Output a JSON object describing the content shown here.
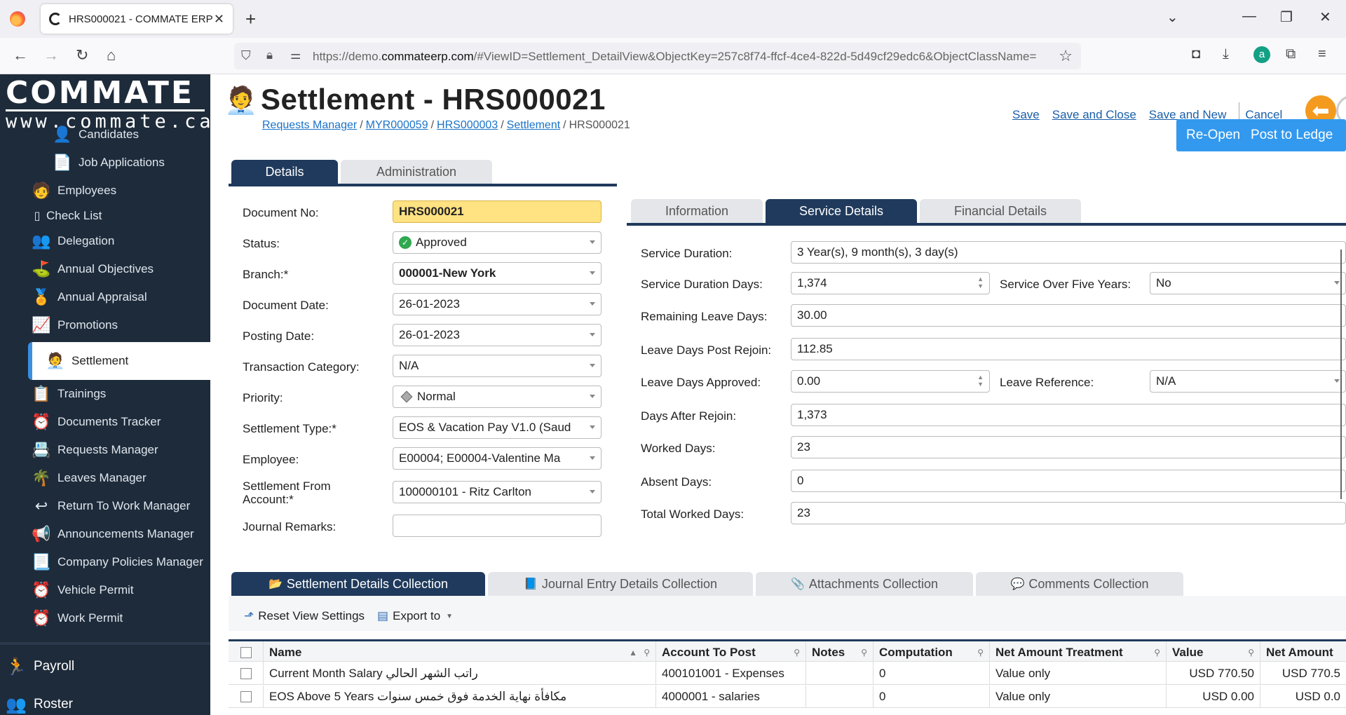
{
  "browser": {
    "tab_title": "HRS000021 - COMMATE ERP",
    "url_prefix": "https://demo.",
    "url_domain": "commateerp.com",
    "url_rest": "/#ViewID=Settlement_DetailView&ObjectKey=257c8f74-ffcf-4ce4-822d-5d49cf29edc6&ObjectClassName="
  },
  "sidebar": {
    "brand": "COMMATE",
    "site": "www.commate.ca",
    "items": [
      {
        "label": "Candidates",
        "icon": "candidate-icon"
      },
      {
        "label": "Job Applications",
        "icon": "document-icon"
      },
      {
        "label": "Employees",
        "icon": "employee-icon"
      },
      {
        "label": "Check List",
        "icon": "checklist-icon"
      },
      {
        "label": "Delegation",
        "icon": "delegation-icon"
      },
      {
        "label": "Annual Objectives",
        "icon": "golf-flag-icon"
      },
      {
        "label": "Annual Appraisal",
        "icon": "award-icon"
      },
      {
        "label": "Promotions",
        "icon": "promotion-icon"
      },
      {
        "label": "Settlement",
        "icon": "settlement-icon"
      },
      {
        "label": "Trainings",
        "icon": "training-icon"
      },
      {
        "label": "Documents Tracker",
        "icon": "clock-icon"
      },
      {
        "label": "Requests Manager",
        "icon": "requests-icon"
      },
      {
        "label": "Leaves Manager",
        "icon": "palm-tree-icon"
      },
      {
        "label": "Return To Work Manager",
        "icon": "return-icon"
      },
      {
        "label": "Announcements Manager",
        "icon": "megaphone-icon"
      },
      {
        "label": "Company Policies Manager",
        "icon": "policy-icon"
      },
      {
        "label": "Vehicle Permit",
        "icon": "clock-icon"
      },
      {
        "label": "Work Permit",
        "icon": "clock-icon"
      }
    ],
    "sections": [
      {
        "label": "Payroll",
        "icon": "payroll-icon"
      },
      {
        "label": "Roster",
        "icon": "roster-icon"
      }
    ]
  },
  "header": {
    "title": "Settlement - HRS000021",
    "breadcrumb": [
      "Requests Manager",
      "MYR000059",
      "HRS000003",
      "Settlement",
      "HRS000021"
    ],
    "actions": [
      "Save",
      "Save and Close",
      "Save and New",
      "Cancel"
    ],
    "reopen_label": "Re-Open",
    "post_label": "Post to Ledge"
  },
  "left_tabs": [
    "Details",
    "Administration"
  ],
  "form": [
    {
      "label": "Document No:",
      "value": "HRS000021"
    },
    {
      "label": "Status:",
      "value": "Approved"
    },
    {
      "label": "Branch:*",
      "value": "000001-New York"
    },
    {
      "label": "Document Date:",
      "value": "26-01-2023"
    },
    {
      "label": "Posting Date:",
      "value": "26-01-2023"
    },
    {
      "label": "Transaction Category:",
      "value": "N/A"
    },
    {
      "label": "Priority:",
      "value": "Normal"
    },
    {
      "label": "Settlement Type:*",
      "value": "EOS & Vacation Pay V1.0 (Saud"
    },
    {
      "label": "Employee:",
      "value": "E00004; E00004-Valentine Ma"
    },
    {
      "label": "Settlement From Account:*",
      "value": "100000101 - Ritz Carlton"
    },
    {
      "label": "Journal Remarks:",
      "value": ""
    }
  ],
  "right_tabs": [
    "Information",
    "Service Details",
    "Financial Details"
  ],
  "service": [
    {
      "label": "Service Duration:",
      "value": "3 Year(s), 9 month(s), 3 day(s)"
    },
    {
      "label": "Service Duration Days:",
      "value": "1,374",
      "side_label": "Service Over Five Years:",
      "side_value": "No"
    },
    {
      "label": "Remaining Leave Days:",
      "value": "30.00"
    },
    {
      "label": "Leave Days Post Rejoin:",
      "value": "112.85"
    },
    {
      "label": "Leave Days Approved:",
      "value": "0.00",
      "side_label": "Leave Reference:",
      "side_value": "N/A"
    },
    {
      "label": "Days After Rejoin:",
      "value": "1,373"
    },
    {
      "label": "Worked Days:",
      "value": "23"
    },
    {
      "label": "Absent Days:",
      "value": "0"
    },
    {
      "label": "Total Worked Days:",
      "value": "23"
    }
  ],
  "collections": [
    {
      "label": "Settlement Details Collection",
      "icon": "folder-icon"
    },
    {
      "label": "Journal Entry Details Collection",
      "icon": "journal-icon"
    },
    {
      "label": "Attachments Collection",
      "icon": "paperclip-icon"
    },
    {
      "label": "Comments Collection",
      "icon": "comments-icon"
    }
  ],
  "toolbar": {
    "reset": "Reset View Settings",
    "export": "Export to"
  },
  "grid": {
    "columns": [
      "Name",
      "Account To Post",
      "Notes",
      "Computation",
      "Net Amount Treatment",
      "Value",
      "Net Amount"
    ],
    "rows": [
      [
        "Current Month Salary راتب الشهر الحالي",
        "400101001 - Expenses",
        "",
        "0",
        "Value only",
        "USD 770.50",
        "USD 770.5"
      ],
      [
        "EOS Above 5 Years مكافأة نهاية الخدمة فوق خمس سنوات",
        "4000001 - salaries",
        "",
        "0",
        "Value only",
        "USD 0.00",
        "USD 0.0"
      ]
    ]
  }
}
